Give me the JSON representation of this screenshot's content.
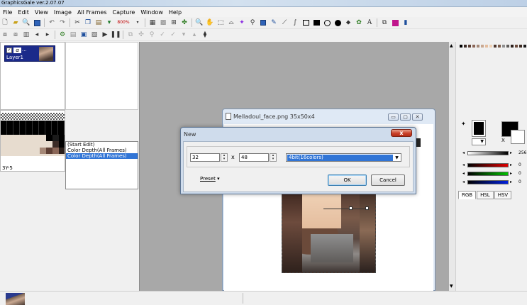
{
  "app": {
    "title": "GraphicsGale ver.2.07.07"
  },
  "menu": [
    "File",
    "Edit",
    "View",
    "Image",
    "All Frames",
    "Capture",
    "Window",
    "Help"
  ],
  "toolbar": {
    "zoom": "800%"
  },
  "layers": {
    "name": "Layer1",
    "alpha": "α",
    "more": "..."
  },
  "palette_panel": {
    "position": "3Y-5"
  },
  "history": {
    "items": [
      "(Start Edit)",
      "Color Depth(All Frames)",
      "Color Depth(All Frames)"
    ],
    "selected_index": 2
  },
  "image_window": {
    "title": "Melladoul_face.png 35x50x4"
  },
  "dialog": {
    "title": "New",
    "width_value": "32",
    "times": "x",
    "height_value": "48",
    "color_depth": "4bit(16colors)",
    "preset_label": "Preset",
    "ok_label": "OK",
    "cancel_label": "Cancel",
    "close_label": "x"
  },
  "color_panel": {
    "x_label": "X",
    "value_256": "256",
    "r": "0",
    "g": "0",
    "b": "0",
    "tabs": [
      "RGB",
      "HSL",
      "HSV"
    ]
  }
}
